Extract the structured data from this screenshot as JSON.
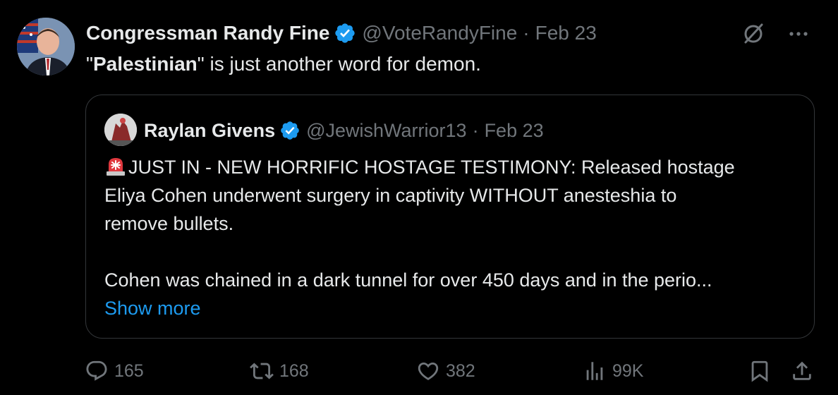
{
  "tweet": {
    "author_name": "Congressman Randy Fine",
    "author_handle": "@VoteRandyFine",
    "separator": "·",
    "date": "Feb 23",
    "text_quote_open": "\"",
    "text_bold": "Palestinian",
    "text_rest": "\" is just another word for demon."
  },
  "quoted": {
    "author_name": "Raylan Givens",
    "author_handle": "@JewishWarrior13",
    "separator": "·",
    "date": "Feb 23",
    "line1": "JUST IN - NEW HORRIFIC HOSTAGE TESTIMONY: Released hostage",
    "line2": "Eliya Cohen underwent surgery in captivity WITHOUT anesteshia to",
    "line3": "remove bullets.",
    "line4": "Cohen was chained in a dark tunnel for over 450 days and in the perio...",
    "show_more": "Show more"
  },
  "actions": {
    "replies": "165",
    "reposts": "168",
    "likes": "382",
    "views": "99K"
  },
  "colors": {
    "background": "#000000",
    "text": "#e7e9ea",
    "muted": "#71767b",
    "link": "#1d9bf0",
    "verified": "#1d9bf0",
    "border": "#333639"
  },
  "icons": [
    "verified-badge-icon",
    "grok-slash-icon",
    "more-icon",
    "siren-emoji-icon",
    "reply-icon",
    "repost-icon",
    "like-icon",
    "views-icon",
    "bookmark-icon",
    "share-icon"
  ]
}
